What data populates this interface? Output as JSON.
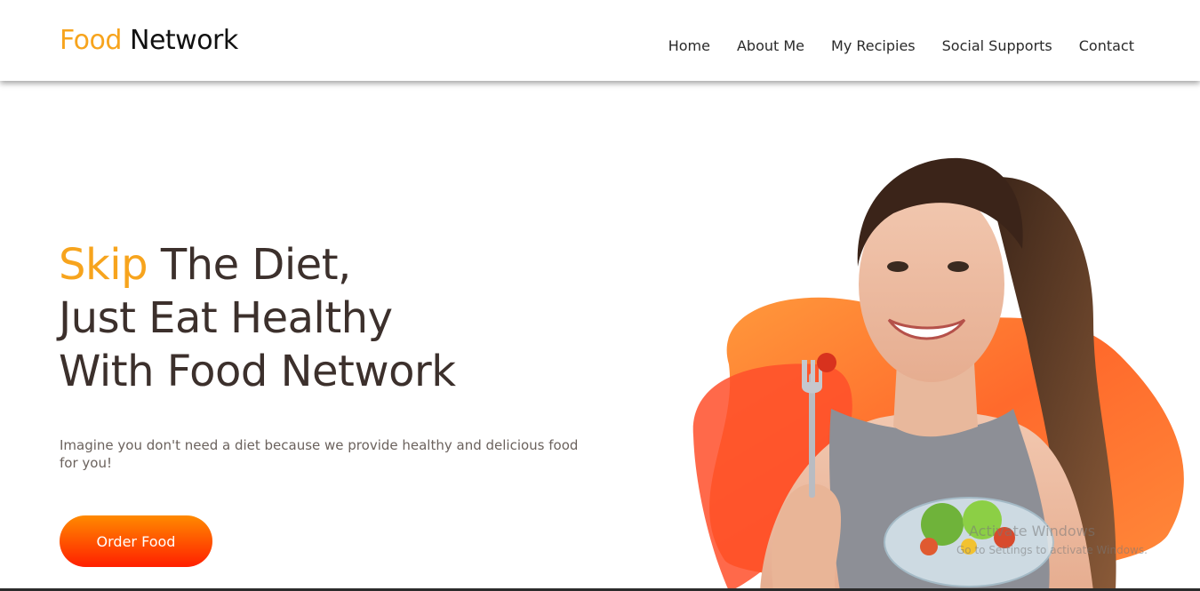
{
  "header": {
    "logo_accent": "Food",
    "logo_rest": "Network",
    "nav": [
      "Home",
      "About Me",
      "My Recipies",
      "Social Supports",
      "Contact"
    ]
  },
  "hero": {
    "title_accent": "Skip",
    "title_line1_rest": "The Diet,",
    "title_line2": "Just Eat Healthy",
    "title_line3": "With Food Network",
    "subtitle": "Imagine you don't need a diet because we provide healthy and delicious food for you!",
    "cta_label": "Order Food",
    "image_alt": "Smiling woman eating a salad with a fork"
  },
  "watermark": {
    "title": "Activate Windows",
    "subtitle": "Go to Settings to activate Windows."
  },
  "colors": {
    "accent": "#f7a41d",
    "heading": "#3c302c",
    "cta_gradient_top": "#ff8a00",
    "cta_gradient_bottom": "#ff1f00",
    "blob_orange": "#ff8c3a",
    "blob_red": "#ff5a2a"
  }
}
